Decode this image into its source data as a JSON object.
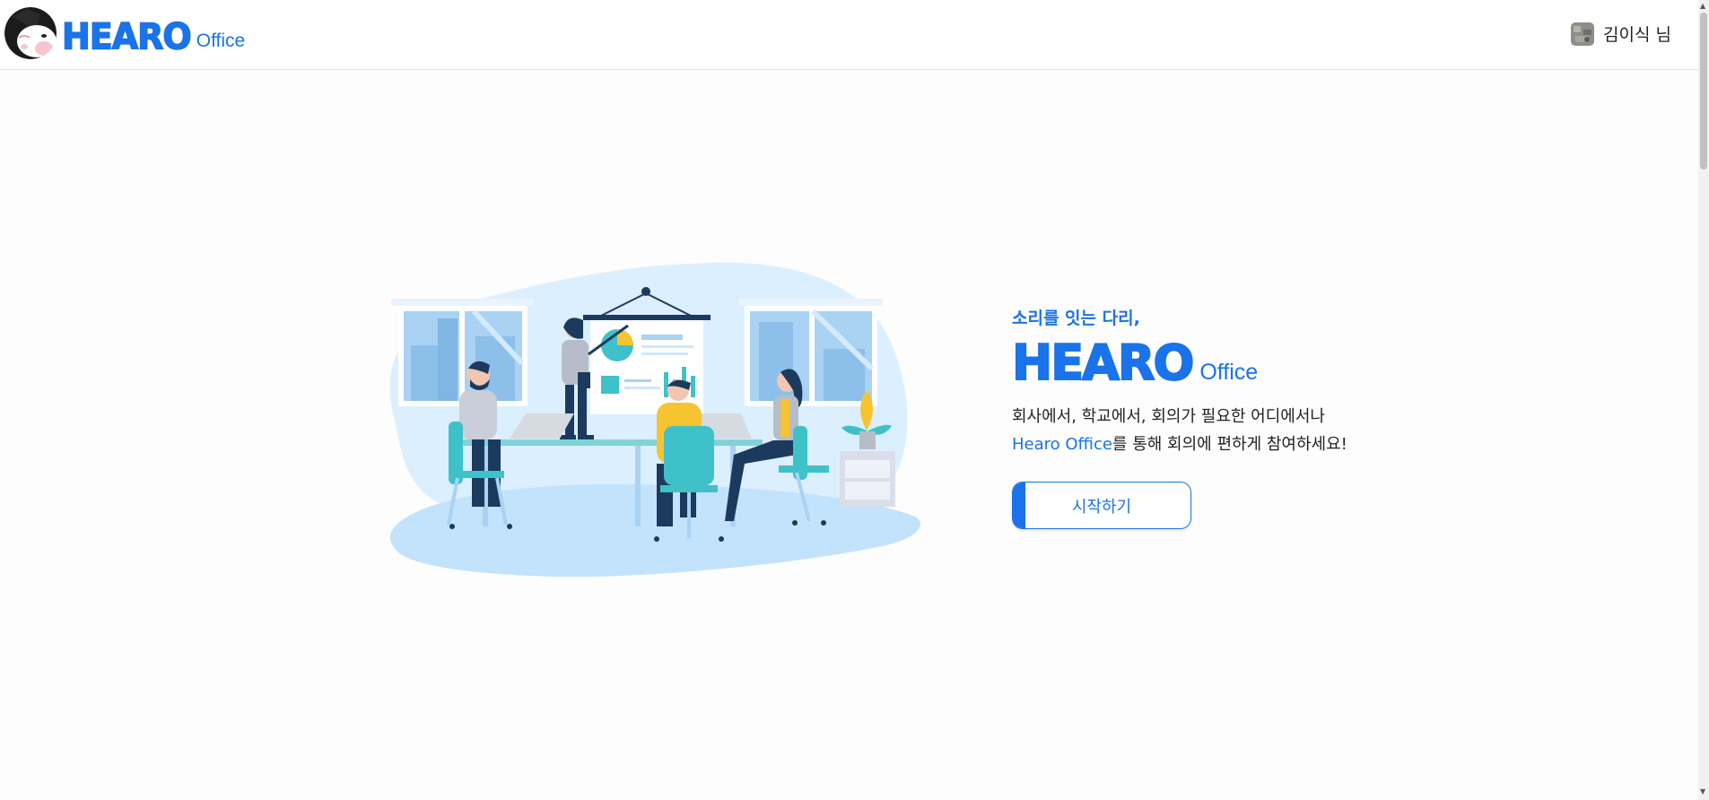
{
  "header": {
    "brand_word": "HEARO",
    "brand_sub": "Office",
    "user_name": "김이식 님"
  },
  "hero": {
    "tagline": "소리를 잇는 다리,",
    "brand_word": "HEARO",
    "brand_sub": "Office",
    "desc_line1": "회사에서, 학교에서, 회의가 필요한 어디에서나",
    "desc_highlight": "Hearo Office",
    "desc_line2_rest": "를 통해 회의에 편하게 참여하세요!",
    "start_label": "시작하기"
  },
  "colors": {
    "accent": "#1a73e8",
    "illustration_light": "#cfe7fb",
    "illustration_teal": "#3fc1c9",
    "illustration_yellow": "#f6c431",
    "illustration_navy": "#1c3a5e"
  },
  "icons": {
    "brand_logo": "mascot-logo-icon",
    "user_avatar": "avatar",
    "scroll_up": "scroll-up-arrow-icon",
    "scroll_down": "scroll-down-arrow-icon"
  }
}
